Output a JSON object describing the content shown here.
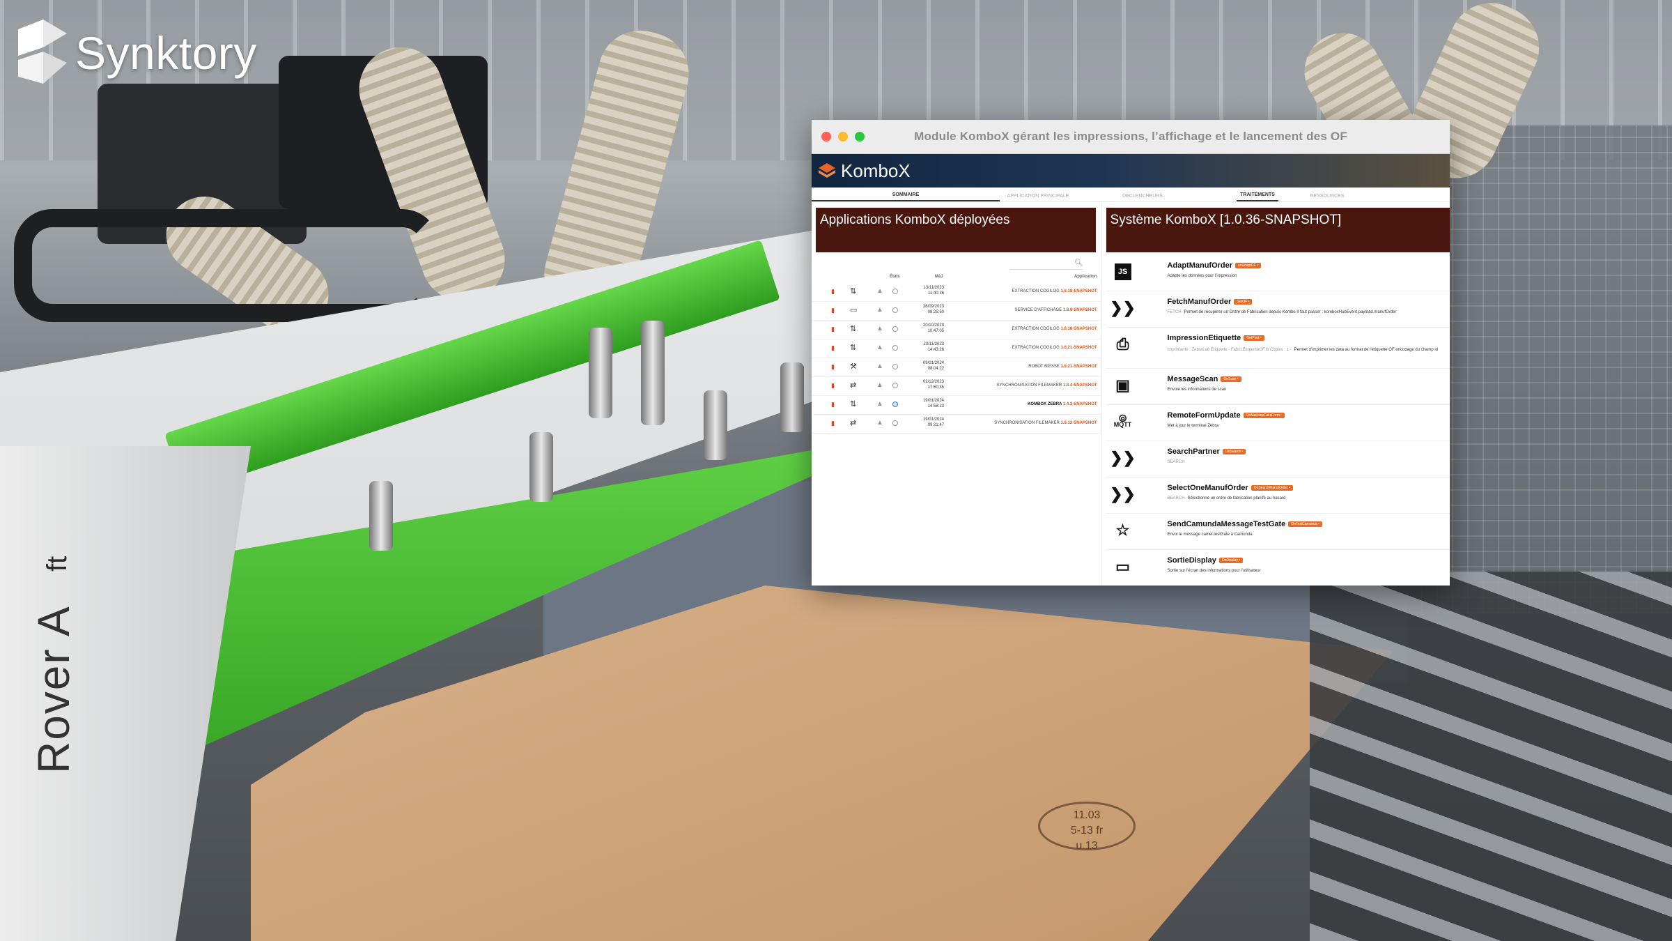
{
  "brand": {
    "name": "Synktory"
  },
  "background": {
    "machine_label": "Rover A",
    "machine_sub": "ft",
    "chalk_text": "11.03\n5-13 fr\nu.13"
  },
  "window": {
    "title": "Module KomboX gérant les impressions, l’affichage et le lancement des OF",
    "app_name": "KomboX",
    "tabs": [
      "SOMMAIRE",
      "APPLICATION PRINCIPALE",
      "DÉCLENCHEURS",
      "TRAITEMENTS",
      "RESSOURCES"
    ]
  },
  "left_pane": {
    "title": "Applications KomboX déployées",
    "columns": {
      "etats": "États",
      "maj": "MàJ",
      "application": "Application"
    },
    "rows": [
      {
        "icon": "transform-icon",
        "date": "13/11/2023",
        "time": "11:40:36",
        "app": "EXTRACTION COGILOG",
        "version": "1.8.18-SNAPSHOT",
        "active": false
      },
      {
        "icon": "monitor-icon",
        "date": "26/09/2023",
        "time": "08:25:50",
        "app": "SERVICE D'AFFICHAGE",
        "version": "1.8.8-SNAPSHOT",
        "active": false
      },
      {
        "icon": "transform-icon",
        "date": "20/10/2023",
        "time": "10:47:05",
        "app": "EXTRACTION COGILOG",
        "version": "1.8.18-SNAPSHOT",
        "active": false
      },
      {
        "icon": "transform-icon",
        "date": "23/11/2023",
        "time": "14:43:26",
        "app": "EXTRACTION COGILOG",
        "version": "1.8.21-SNAPSHOT",
        "active": false
      },
      {
        "icon": "robot-icon",
        "date": "09/01/2024",
        "time": "08:04:22",
        "app": "ROBOT BIESSE",
        "version": "1.8.21-SNAPSHOT",
        "active": false
      },
      {
        "icon": "sync-icon",
        "date": "02/12/2023",
        "time": "17:50:35",
        "app": "SYNCHRONISATION FILEMAKER",
        "version": "1.8.4-SNAPSHOT",
        "active": false
      },
      {
        "icon": "transform-icon",
        "date": "19/01/2024",
        "time": "14:58:23",
        "app": "KOMBOX ZEBRA",
        "version": "1.4.2-SNAPSHOT",
        "active": true
      },
      {
        "icon": "sync-icon",
        "date": "19/01/2024",
        "time": "09:21:47",
        "app": "SYNCHRONISATION FILEMAKER",
        "version": "1.8.12-SNAPSHOT",
        "active": false
      }
    ]
  },
  "right_pane": {
    "title": "Système KomboX [1.0.36-SNAPSHOT]",
    "items": [
      {
        "icon": "js-icon",
        "glyph": "JS",
        "name": "AdaptManufOrder",
        "badge": "onAdaptOF •",
        "prefix": "",
        "desc": "Adapte les données pour l'impression"
      },
      {
        "icon": "chevrons-icon",
        "glyph": "❯❯",
        "name": "FetchManufOrder",
        "badge": "GetOF •",
        "prefix": "FETCH",
        "desc": "Permet de récupérer un Ordre de Fabrication depuis Kombo Il faut passer : komboxHubEvent.payload.manufOrder"
      },
      {
        "icon": "printer-icon",
        "glyph": "⎙",
        "name": "ImpressionEtiquette",
        "badge": "GetPrint •",
        "prefix": "Imprimante : ZebraLab Etiquette - FabricEtiquetteOF.fit Copies : 1 -",
        "desc": "Permet d'imprimer les data au format de l'étiquette OF encodage du champ id"
      },
      {
        "icon": "scan-icon",
        "glyph": "▣",
        "name": "MessageScan",
        "badge": "OnScan •",
        "prefix": "",
        "desc": "Envoie les informations de scan"
      },
      {
        "icon": "mqtt-icon",
        "glyph": "MQTT",
        "name": "RemoteFormUpdate",
        "badge": "OnMachineFaitsForm •",
        "prefix": "",
        "desc": "Met à jour le terminal Zebra"
      },
      {
        "icon": "chevrons-icon",
        "glyph": "❯❯",
        "name": "SearchPartner",
        "badge": "OnSearch •",
        "prefix": "SEARCH",
        "desc": ""
      },
      {
        "icon": "chevrons-icon",
        "glyph": "❯❯",
        "name": "SelectOneManufOrder",
        "badge": "OnSearchManufOrder •",
        "prefix": "SEARCH",
        "desc": "Sélectionne un ordre de fabrication planifé au hasard"
      },
      {
        "icon": "star-icon",
        "glyph": "☆",
        "name": "SendCamundaMessageTestGate",
        "badge": "OnTestCamunda •",
        "prefix": "",
        "desc": "Envoi le message camel.testGate à Camunda"
      },
      {
        "icon": "monitor-icon",
        "glyph": "▭",
        "name": "SortieDisplay",
        "badge": "OnDisplay •",
        "prefix": "",
        "desc": "Sortie sur l'écran des informations pour l'utilisateur"
      }
    ]
  },
  "colors": {
    "pane_header": "#4a170e",
    "badge": "#ea6b23",
    "delete": "#d9482b",
    "machine_green": "#4cc236"
  }
}
